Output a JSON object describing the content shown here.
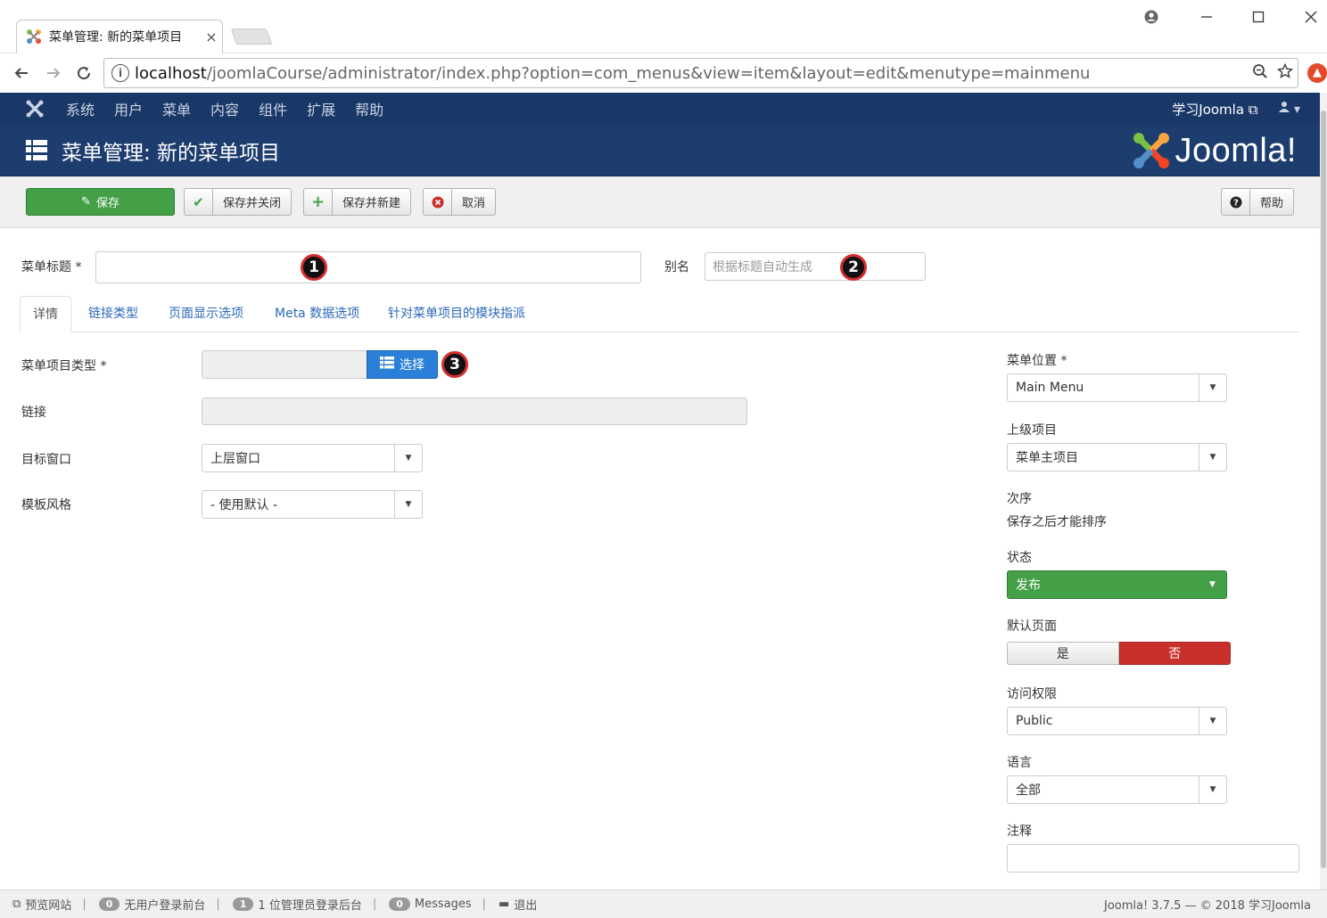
{
  "browser": {
    "tab_title": "菜单管理: 新的菜单项目",
    "tab_close": "×",
    "url_host": "localhost",
    "url_path": "/joomlaCourse/administrator/index.php?option=com_menus&view=item&layout=edit&menutype=mainmenu"
  },
  "topbar": {
    "menu": [
      "系统",
      "用户",
      "菜单",
      "内容",
      "组件",
      "扩展",
      "帮助"
    ],
    "site_link": "学习Joomla"
  },
  "header": {
    "title": "菜单管理: 新的菜单项目",
    "brand": "Joomla!"
  },
  "toolbar": {
    "save": "保存",
    "save_close": "保存并关闭",
    "save_new": "保存并新建",
    "cancel": "取消",
    "help": "帮助"
  },
  "form": {
    "title_label": "菜单标题 *",
    "title_value": "",
    "alias_label": "别名",
    "alias_placeholder": "根据标题自动生成",
    "badges": [
      "1",
      "2",
      "3"
    ]
  },
  "tabs": [
    "详情",
    "链接类型",
    "页面显示选项",
    "Meta 数据选项",
    "针对菜单项目的模块指派"
  ],
  "details": {
    "type_label": "菜单项目类型 *",
    "choose_button": "选择",
    "link_label": "链接",
    "target_label": "目标窗口",
    "target_value": "上层窗口",
    "template_label": "模板风格",
    "template_value": "- 使用默认 -"
  },
  "sidebar": {
    "menu_position_label": "菜单位置 *",
    "menu_position_value": "Main Menu",
    "parent_label": "上级项目",
    "parent_value": "菜单主项目",
    "ordering_label": "次序",
    "ordering_text": "保存之后才能排序",
    "status_label": "状态",
    "status_value": "发布",
    "default_page_label": "默认页面",
    "default_yes": "是",
    "default_no": "否",
    "access_label": "访问权限",
    "access_value": "Public",
    "language_label": "语言",
    "language_value": "全部",
    "note_label": "注释"
  },
  "footer": {
    "preview": "预览网站",
    "visitors_count": "0",
    "visitors_text": "无用户登录前台",
    "admins_count": "1",
    "admins_text": "1 位管理员登录后台",
    "messages_count": "0",
    "messages_text": "Messages",
    "logout": "退出",
    "version": "Joomla! 3.7.5 — © 2018 学习Joomla"
  },
  "colors": {
    "topbar": "#1a3867",
    "titlebar": "#1c3d6e",
    "save_green": "#43a047",
    "choose_blue": "#2a80d8",
    "no_red": "#c9302c",
    "link_blue": "#2a69b8"
  }
}
